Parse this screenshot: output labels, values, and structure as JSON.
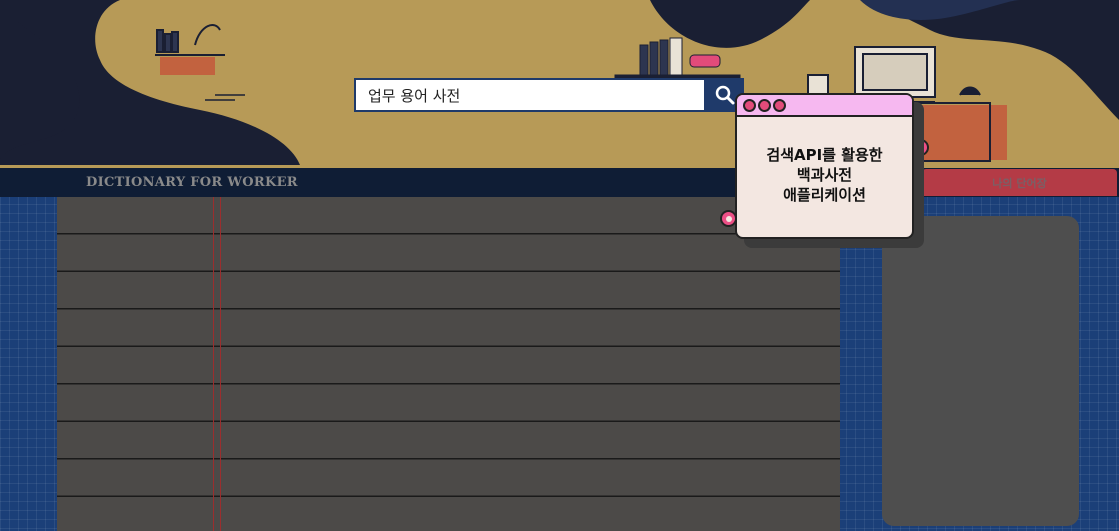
{
  "header": {
    "search": {
      "value": "업무 용어 사전",
      "placeholder": "",
      "button_icon": "search-icon"
    }
  },
  "board": {
    "brand": "DICTIONARY FOR WORKER",
    "vocab_tab": "나의 단어장"
  },
  "popup": {
    "lines": [
      "검색API를 활용한",
      "백과사전",
      "애플리케이션"
    ],
    "dots": [
      "dot",
      "dot",
      "dot"
    ]
  },
  "colors": {
    "hero_bg": "#b79a57",
    "board_bg": "#1b3f78",
    "search_accent": "#1f3a6a",
    "tab_red": "#b43b46",
    "popup_bar": "#f6b8f0",
    "popup_bg": "#f3e7e1",
    "ring_pink": "#ec4f86"
  }
}
